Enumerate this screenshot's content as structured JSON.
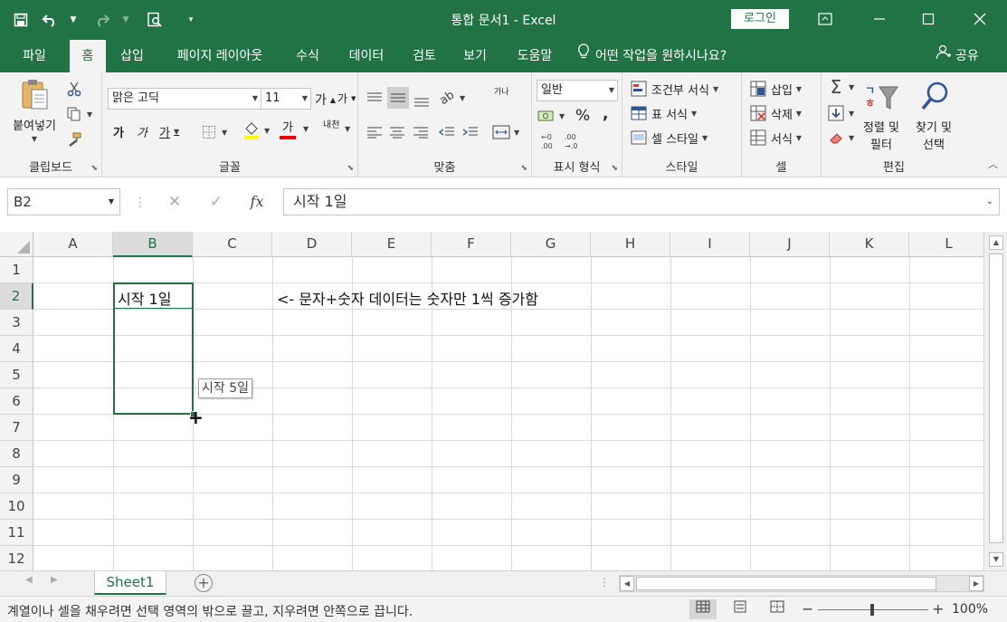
{
  "window": {
    "title": "통합 문서1  -  Excel",
    "login_label": "로그인"
  },
  "tabs": [
    {
      "label": "파일"
    },
    {
      "label": "홈"
    },
    {
      "label": "삽입"
    },
    {
      "label": "페이지 레이아웃"
    },
    {
      "label": "수식"
    },
    {
      "label": "데이터"
    },
    {
      "label": "검토"
    },
    {
      "label": "보기"
    },
    {
      "label": "도움말"
    }
  ],
  "tell_me": "어떤 작업을 원하시나요?",
  "share_label": "공유",
  "ribbon": {
    "clipboard": {
      "paste_label": "붙여넣기",
      "group_label": "클립보드"
    },
    "font": {
      "font_name": "맑은 고딕",
      "font_size": "11",
      "group_label": "글꼴",
      "bold": "가",
      "italic": "가",
      "underline": "가",
      "grow": "가",
      "shrink": "가",
      "phonetic": "내천",
      "font_color_glyph": "가"
    },
    "alignment": {
      "group_label": "맞춤",
      "wrap_glyph": "가나"
    },
    "number": {
      "format": "일반",
      "group_label": "표시 형식",
      "percent": "%",
      "comma": ","
    },
    "styles": {
      "conditional": "조건부 서식",
      "table": "표 서식",
      "cell": "셀 스타일",
      "group_label": "스타일"
    },
    "cells": {
      "insert": "삽입",
      "delete": "삭제",
      "format": "서식",
      "group_label": "셀"
    },
    "editing": {
      "sort_line1": "정렬 및",
      "sort_line2": "필터",
      "find_line1": "찾기 및",
      "find_line2": "선택",
      "group_label": "편집"
    }
  },
  "formula_bar": {
    "name_box": "B2",
    "fx": "fx",
    "content": "시작 1일"
  },
  "grid": {
    "columns": [
      "A",
      "B",
      "C",
      "D",
      "E",
      "F",
      "G",
      "H",
      "I",
      "J",
      "K",
      "L"
    ],
    "rows": [
      "1",
      "2",
      "3",
      "4",
      "5",
      "6",
      "7",
      "8",
      "9",
      "10",
      "11",
      "12"
    ],
    "selected_column": "B",
    "selected_row": "2",
    "cells": {
      "B2": "시작 1일",
      "D2": "<- 문자+숫자 데이터는 숫자만 1씩 증가함"
    },
    "fill_tooltip": "시작 5일"
  },
  "sheets": [
    {
      "name": "Sheet1"
    }
  ],
  "status": {
    "message": "계열이나 셀을 채우려면 선택 영역의 밖으로 끌고, 지우려면 안쪽으로 끕니다.",
    "zoom": "100%"
  },
  "colors": {
    "accent": "#217346"
  }
}
